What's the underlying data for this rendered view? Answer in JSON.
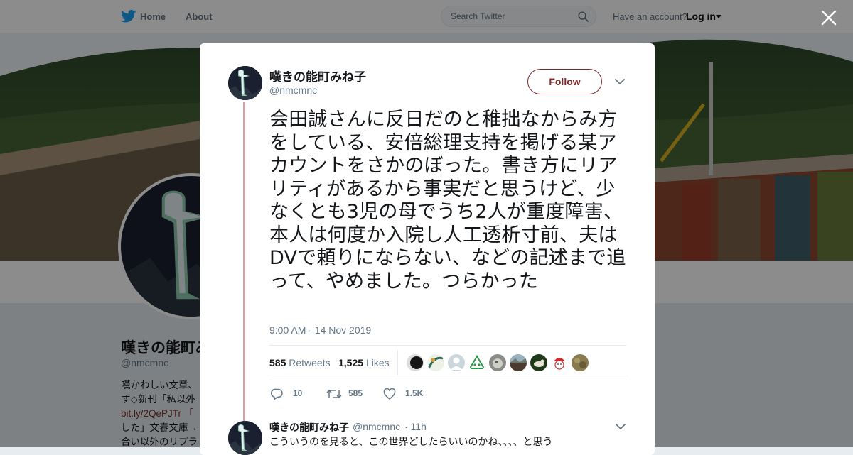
{
  "nav": {
    "home_label": "Home",
    "about_label": "About",
    "search_placeholder": "Search Twitter",
    "have_account": "Have an account?",
    "login_label": "Log in"
  },
  "profile": {
    "name": "嘆きの能町みね子",
    "handle": "@nmcmnc",
    "bio_lines": [
      "嘆かわしい文章、",
      "す◇新刊「私以外",
      "bit.ly/2QePJTr 「",
      "した」文春文庫→",
      "合い以外のリプラ"
    ]
  },
  "tweet": {
    "author_name": "嘆きの能町みね子",
    "author_handle": "@nmcmnc",
    "follow_label": "Follow",
    "text": "会田誠さんに反日だのと稚拙なからみ方をしている、安倍総理支持を掲げる某アカウントをさかのぼった。書き方にリアリティがあるから事実だと思うけど、少なくとも3児の母でうち2人が重度障害、本人は何度か入院し人工透析寸前、夫はDVで頼りにならない、などの記述まで追って、やめました。つらかった",
    "timestamp": "9:00 AM - 14 Nov 2019",
    "retweets_count": "585",
    "retweets_label": "Retweets",
    "likes_count": "1,525",
    "likes_label": "Likes",
    "replies_action": "10",
    "retweets_action": "585",
    "likes_action": "1.5K"
  },
  "reply": {
    "author_name": "嘆きの能町みね子",
    "author_handle": "@nmcmnc",
    "time": "· 11h",
    "text": "こういうのを見ると、この世界どしたらいいのかね、、、、と思う"
  },
  "colors": {
    "accent": "#7f2a2a",
    "thread_line": "#cfa3a7",
    "twitter_blue": "#1da1f2",
    "secondary_text": "#657786"
  },
  "icons": [
    "twitter-bird-icon",
    "search-icon",
    "close-icon",
    "chevron-down-icon",
    "reply-icon",
    "retweet-icon",
    "heart-icon"
  ]
}
